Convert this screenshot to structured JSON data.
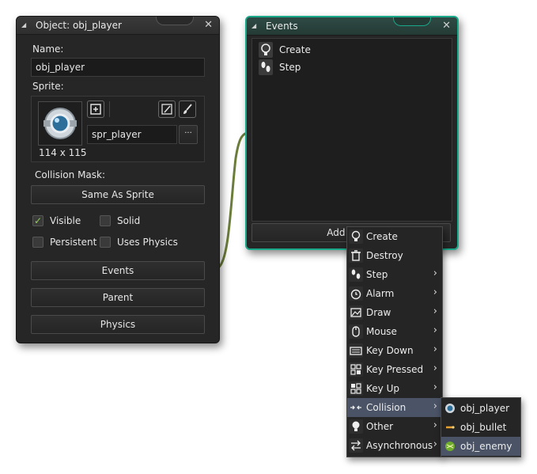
{
  "object_window": {
    "title": "Object: obj_player",
    "name_label": "Name:",
    "name_value": "obj_player",
    "sprite_label": "Sprite:",
    "sprite_size": "114 x 115",
    "sprite_name": "spr_player",
    "sprite_menu_button": "···",
    "collision_mask_label": "Collision Mask:",
    "collision_mask_value": "Same As Sprite",
    "checkboxes": {
      "visible": {
        "label": "Visible",
        "checked": true
      },
      "solid": {
        "label": "Solid",
        "checked": false
      },
      "persistent": {
        "label": "Persistent",
        "checked": false
      },
      "uses_physics": {
        "label": "Uses Physics",
        "checked": false
      }
    },
    "buttons": {
      "events": "Events",
      "parent": "Parent",
      "physics": "Physics"
    }
  },
  "events_window": {
    "title": "Events",
    "events": [
      "Create",
      "Step"
    ],
    "add_button": "Add Event"
  },
  "event_menu": {
    "items": [
      "Create",
      "Destroy",
      "Step",
      "Alarm",
      "Draw",
      "Mouse",
      "Key Down",
      "Key Pressed",
      "Key Up",
      "Collision",
      "Other",
      "Asynchronous"
    ],
    "highlighted": "Collision"
  },
  "collision_submenu": {
    "items": [
      "obj_player",
      "obj_bullet",
      "obj_enemy"
    ],
    "highlighted": "obj_enemy"
  },
  "colors": {
    "panel_bg": "#262626",
    "accent_teal": "#1aa88a",
    "menu_highlight": "#4a5466",
    "check_green": "#8fd14f"
  }
}
